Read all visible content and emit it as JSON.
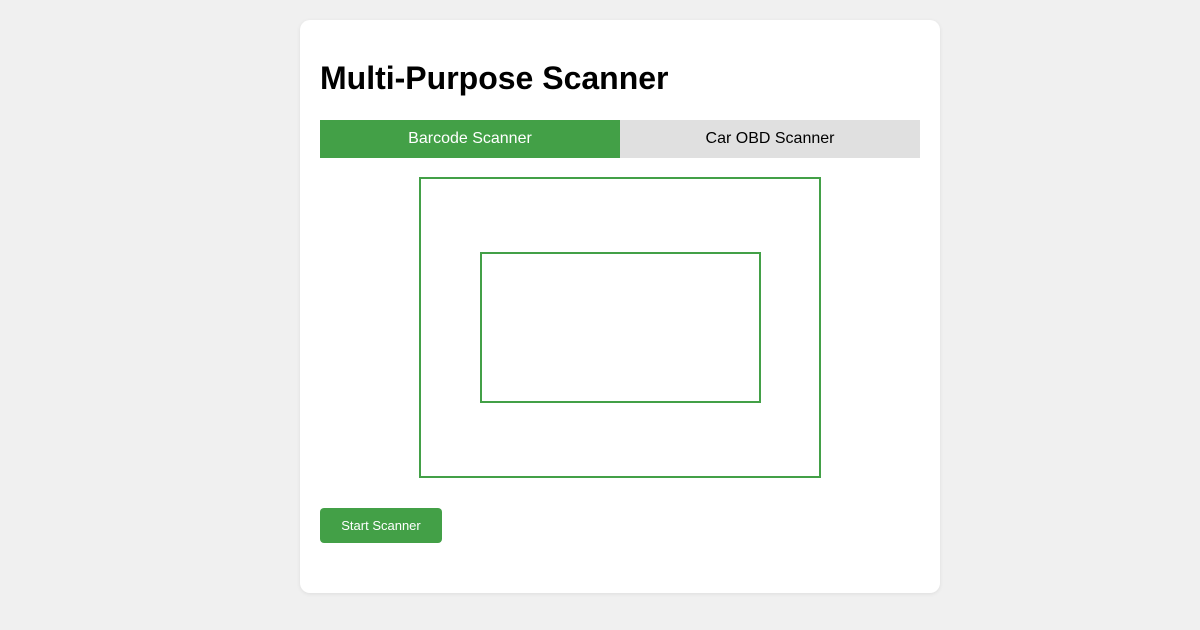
{
  "app": {
    "title": "Multi-Purpose Scanner"
  },
  "tabs": [
    {
      "label": "Barcode Scanner",
      "active": true
    },
    {
      "label": "Car OBD Scanner",
      "active": false
    }
  ],
  "controls": {
    "start_label": "Start Scanner"
  },
  "colors": {
    "accent": "#43a047",
    "tab_inactive": "#e0e0e0",
    "background": "#f0f0f0",
    "card": "#ffffff"
  }
}
